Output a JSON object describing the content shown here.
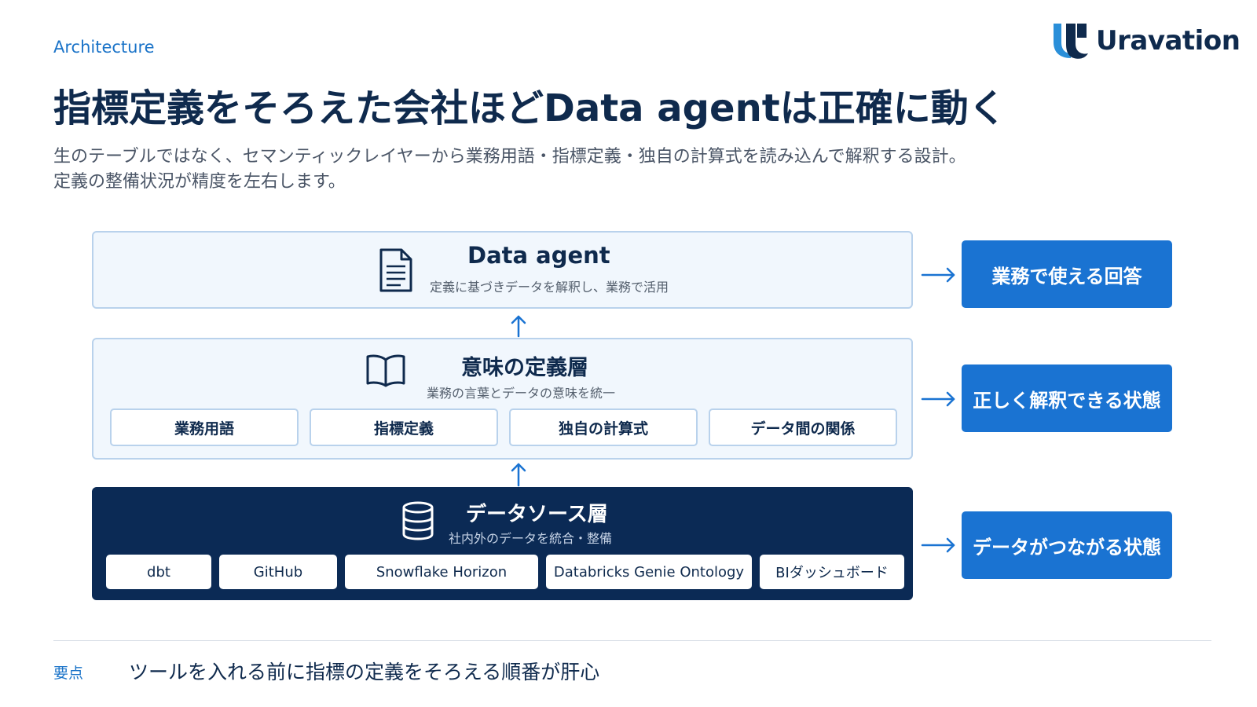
{
  "header": {
    "section_label": "Architecture",
    "logo_text": "Uravation",
    "title": "指標定義をそろえた会社ほどData agentは正確に動く",
    "subtitle_line1": "生のテーブルではなく、セマンティックレイヤーから業務用語・指標定義・独自の計算式を読み込んで解釈する設計。",
    "subtitle_line2": "定義の整備状況が精度を左右します。"
  },
  "diagram": {
    "agent_layer": {
      "icon": "document-icon",
      "title": "Data agent",
      "description": "定義に基づきデータを解釈し、業務で活用"
    },
    "semantic_layer": {
      "icon": "open-book-icon",
      "title": "意味の定義層",
      "description": "業務の言葉とデータの意味を統一",
      "items": [
        "業務用語",
        "指標定義",
        "独自の計算式",
        "データ間の関係"
      ]
    },
    "source_layer": {
      "icon": "database-icon",
      "title": "データソース層",
      "description": "社内外のデータを統合・整備",
      "items": [
        "dbt",
        "GitHub",
        "Snowflake Horizon",
        "Databricks Genie Ontology",
        "BIダッシュボード"
      ]
    },
    "results": [
      "業務で使える回答",
      "正しく解釈できる状態",
      "データがつながる状態"
    ]
  },
  "footer": {
    "key_label": "要点",
    "key_text": "ツールを入れる前に指標の定義をそろえる順番が肝心"
  },
  "colors": {
    "navy": "#0f2a4d",
    "accent_blue": "#1a73d2",
    "dark_layer": "#0b2a55",
    "light_layer": "#f1f7fd",
    "layer_border": "#b9d2ec"
  }
}
